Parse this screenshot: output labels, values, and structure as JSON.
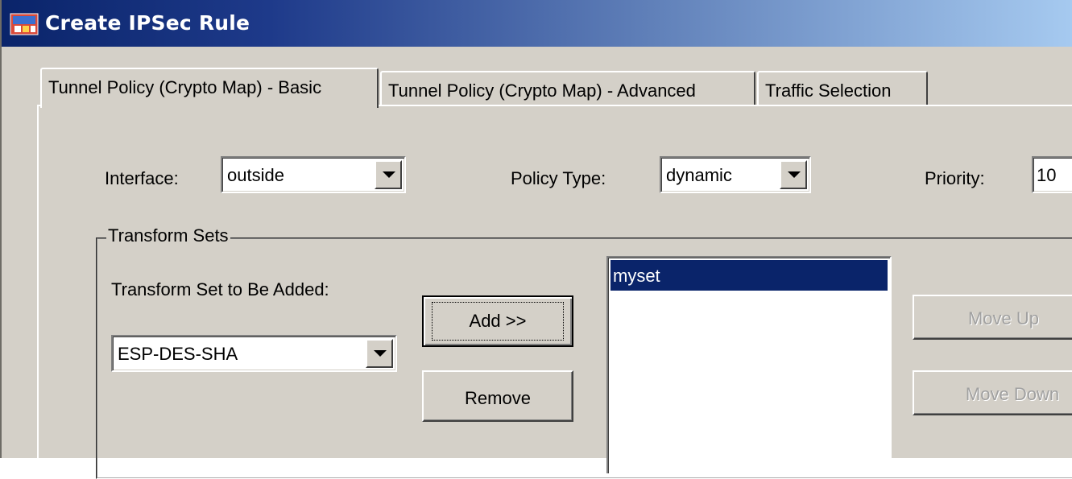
{
  "window": {
    "title": "Create IPSec Rule",
    "icon": "ipsec-app-icon"
  },
  "tabs": [
    {
      "label": "Tunnel Policy (Crypto Map) - Basic",
      "active": true
    },
    {
      "label": "Tunnel Policy (Crypto Map) - Advanced",
      "active": false
    },
    {
      "label": "Traffic Selection",
      "active": false
    }
  ],
  "fields": {
    "interface_label": "Interface:",
    "interface_value": "outside",
    "policy_type_label": "Policy Type:",
    "policy_type_value": "dynamic",
    "priority_label": "Priority:",
    "priority_value": "10"
  },
  "transform_sets": {
    "group_title": "Transform Sets",
    "to_be_added_label": "Transform Set to Be Added:",
    "to_be_added_value": "ESP-DES-SHA",
    "add_label": "Add >>",
    "remove_label": "Remove",
    "list_items": [
      "myset"
    ],
    "selected_item": "myset",
    "move_up_label": "Move Up",
    "move_down_label": "Move Down"
  },
  "colors": {
    "titlebar_start": "#0a246a",
    "titlebar_end": "#a6caf0",
    "selection": "#0a246a",
    "face": "#d4d0c8"
  }
}
